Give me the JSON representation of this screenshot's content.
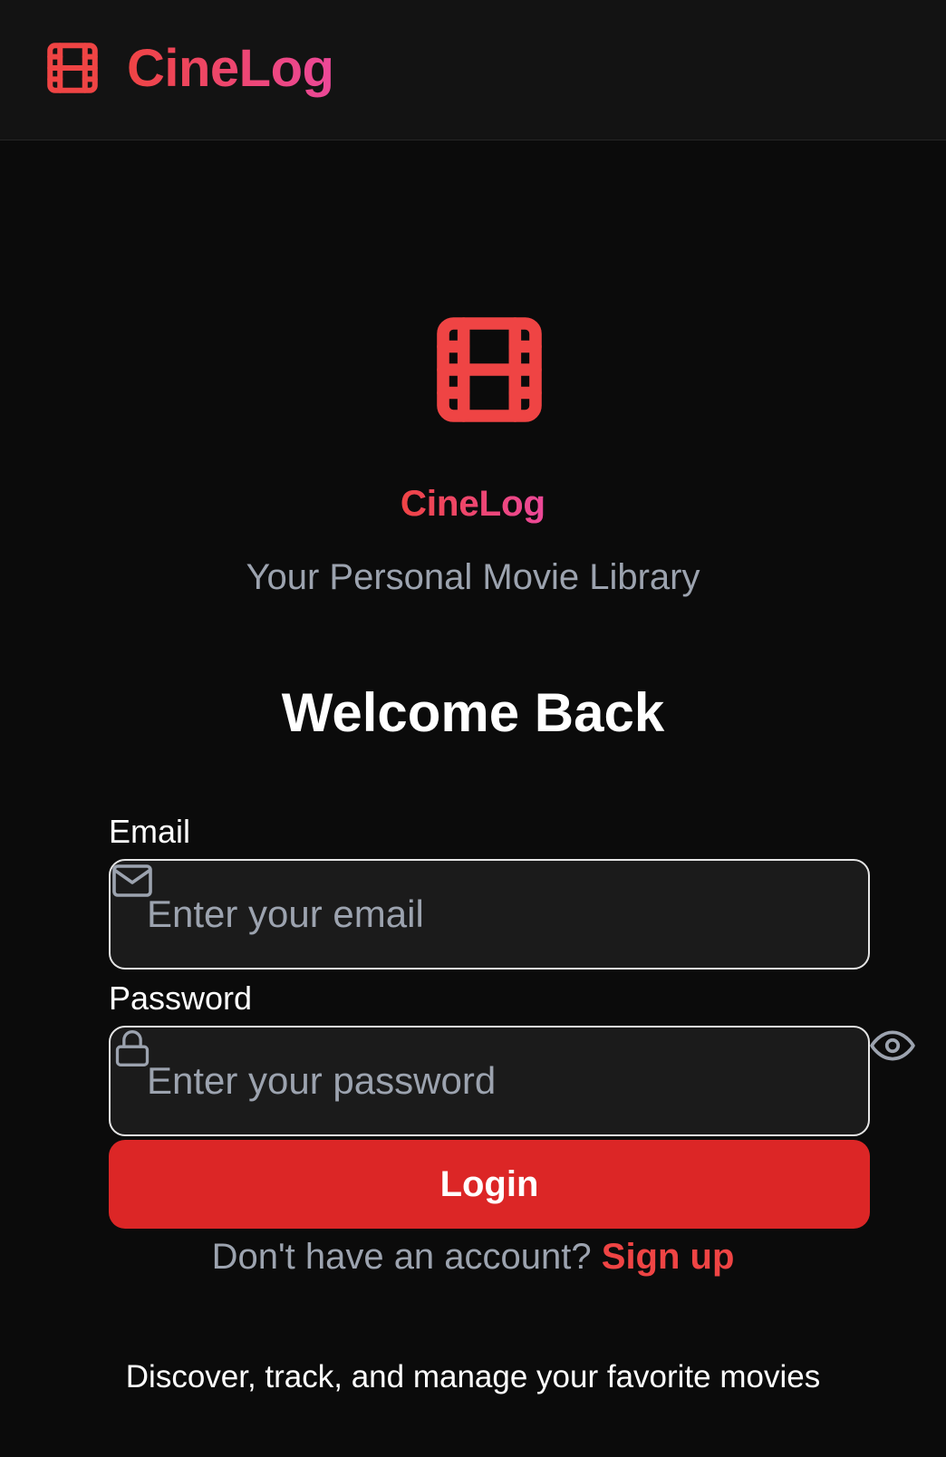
{
  "header": {
    "brand": "CineLog",
    "logo_icon": "film-icon"
  },
  "hero": {
    "logo_icon": "film-icon",
    "title": "CineLog",
    "tagline": "Your Personal Movie Library"
  },
  "form": {
    "heading": "Welcome Back",
    "email": {
      "label": "Email",
      "placeholder": "Enter your email",
      "value": "",
      "icon": "mail-icon"
    },
    "password": {
      "label": "Password",
      "placeholder": "Enter your password",
      "value": "",
      "icon": "lock-icon",
      "toggle_icon": "eye-icon"
    },
    "login_label": "Login",
    "signup_prompt": "Don't have an account?",
    "signup_link": "Sign up"
  },
  "footer": {
    "text": "Discover, track, and manage your favorite movies"
  },
  "colors": {
    "accent_red": "#ef4444",
    "accent_pink": "#ec4899",
    "button_red": "#dc2626",
    "background": "#0b0b0b",
    "header_background": "#131313",
    "input_background": "#1b1b1b",
    "muted_text": "#9ca3af"
  }
}
